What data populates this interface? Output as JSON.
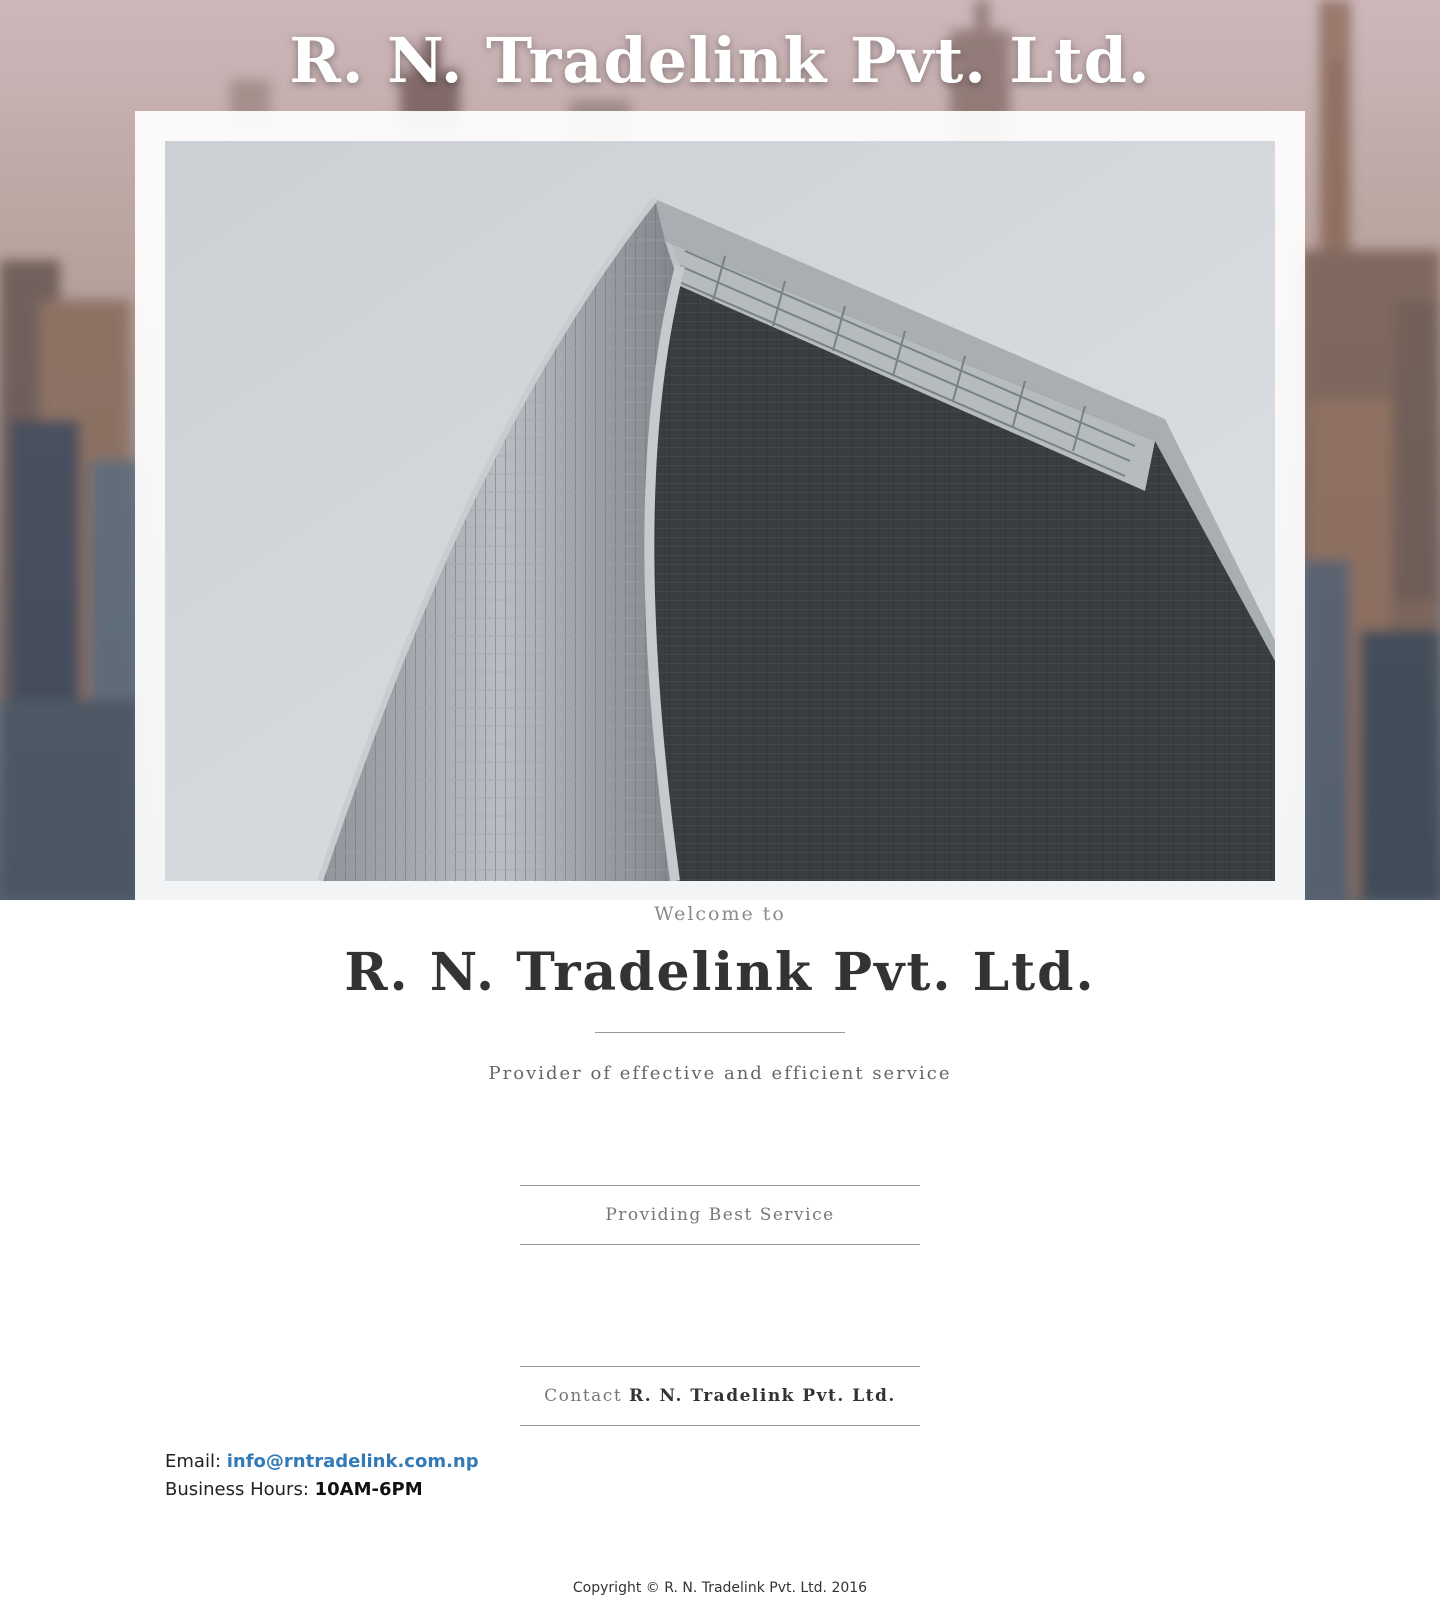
{
  "header": {
    "title": "R. N. Tradelink Pvt. Ltd."
  },
  "intro": {
    "welcome": "Welcome to",
    "company": "R. N. Tradelink Pvt. Ltd.",
    "tagline": "Provider of effective and efficient service"
  },
  "service_section": {
    "heading": "Providing Best Service"
  },
  "contact_section": {
    "heading_prefix": "Contact",
    "heading_company": "R. N. Tradelink Pvt. Ltd.",
    "email_label": "Email:",
    "email": "info@rntradelink.com.np",
    "hours_label": "Business Hours:",
    "hours": "10AM-6PM"
  },
  "footer": {
    "copyright": "Copyright © R. N. Tradelink Pvt. Ltd. 2016"
  },
  "colors": {
    "link": "#337ab7",
    "text": "#333333",
    "rule": "#999999"
  },
  "images": {
    "hero_background": "blurred-city-skyline",
    "feature_photo": "curved-glass-skyscraper"
  }
}
